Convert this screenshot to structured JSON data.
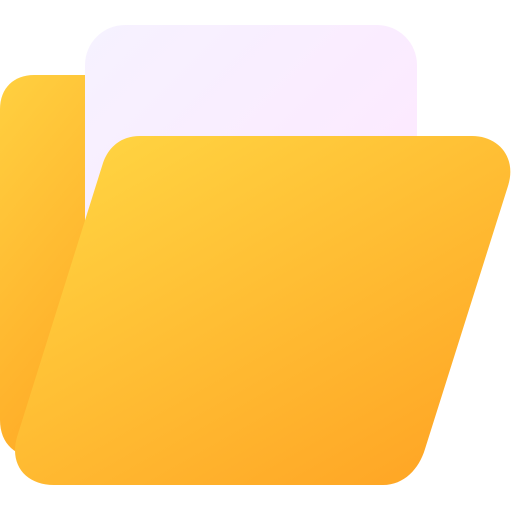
{
  "icon": {
    "name": "open-folder-icon",
    "colors": {
      "back_panel_light": "#FFD040",
      "back_panel_dark": "#FFA422",
      "front_panel_light": "#FFD542",
      "front_panel_dark": "#FFA424",
      "paper_light": "#F6F2FF",
      "paper_dark": "#FFE6FF"
    }
  }
}
